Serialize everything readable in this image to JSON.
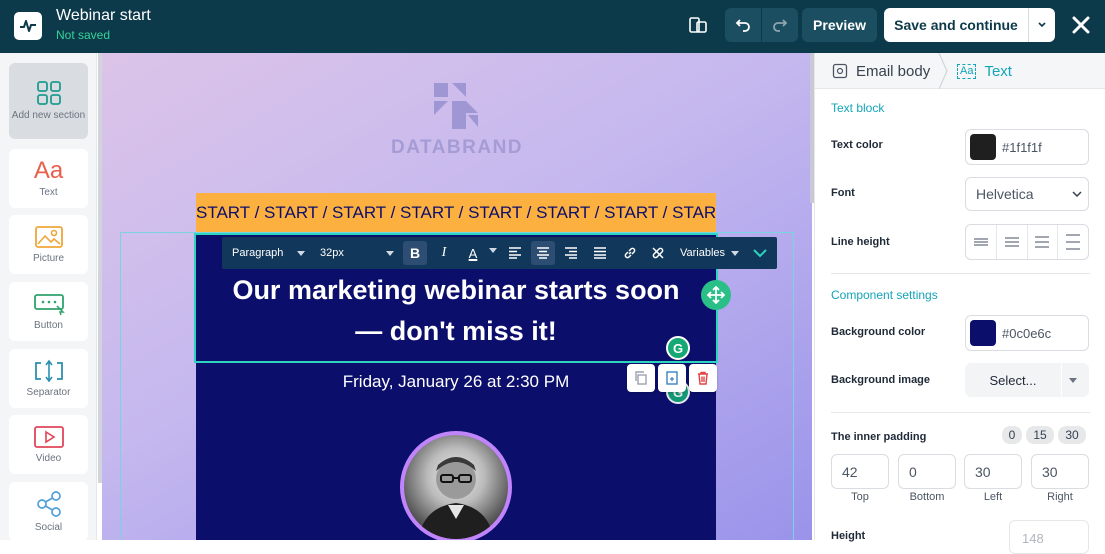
{
  "header": {
    "title": "Webinar start",
    "status": "Not saved",
    "preview_label": "Preview",
    "save_label": "Save and continue"
  },
  "sidebar": {
    "items": [
      {
        "label": "Add new section",
        "icon": "grid-icon"
      },
      {
        "label": "Text",
        "icon": "text-aa-icon"
      },
      {
        "label": "Picture",
        "icon": "image-icon"
      },
      {
        "label": "Button",
        "icon": "button-icon"
      },
      {
        "label": "Separator",
        "icon": "separator-icon"
      },
      {
        "label": "Video",
        "icon": "video-play-icon"
      },
      {
        "label": "Social",
        "icon": "share-icon"
      }
    ]
  },
  "canvas": {
    "brand_name": "DATABRAND",
    "ticker_text": "START / START / START / START / START / START / START / START / START",
    "heading_line1": "Our marketing webinar starts soon",
    "heading_line2": "— don't miss it!",
    "date_text": "Friday, January 26 at 2:30 PM",
    "grammarly_glyph": "G"
  },
  "text_toolbar": {
    "paragraph": "Paragraph",
    "font_size": "32px",
    "bold": "B",
    "italic": "I",
    "text_color": "A",
    "variables": "Variables"
  },
  "panel": {
    "breadcrumb_email_body": "Email body",
    "breadcrumb_text": "Text",
    "text_block_title": "Text block",
    "text_color_label": "Text color",
    "text_color_value": "#1f1f1f",
    "font_label": "Font",
    "font_value": "Helvetica",
    "line_height_label": "Line height",
    "component_settings_title": "Component settings",
    "bg_color_label": "Background color",
    "bg_color_value": "#0c0e6c",
    "bg_image_label": "Background image",
    "bg_image_select": "Select...",
    "inner_padding_label": "The inner padding",
    "padding_presets": [
      "0",
      "15",
      "30"
    ],
    "padding": {
      "top_value": "42",
      "top_label": "Top",
      "bottom_value": "0",
      "bottom_label": "Bottom",
      "left_value": "30",
      "left_label": "Left",
      "right_value": "30",
      "right_label": "Right"
    },
    "height_label": "Height",
    "height_value": "148"
  },
  "colors": {
    "header_bg": "#0d3a4a",
    "accent_green": "#34d399",
    "accent_teal": "#14a5b8",
    "ticker_bg": "#fbb040",
    "email_bg": "#0c0e6c",
    "text_color": "#1f1f1f"
  }
}
